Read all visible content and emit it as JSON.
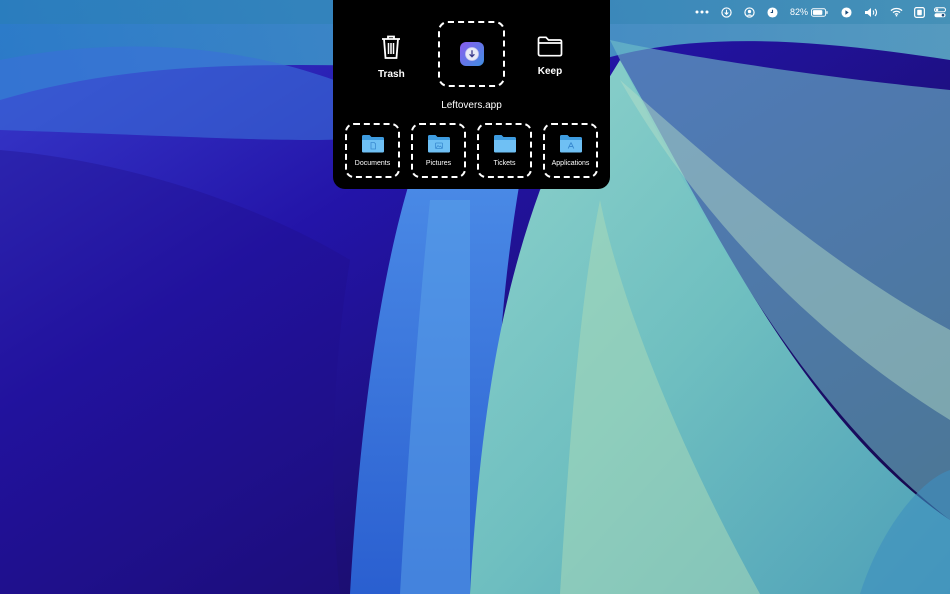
{
  "menubar": {
    "battery_percent": "82%",
    "icons": [
      "more-icon",
      "download-icon",
      "user-circle-icon",
      "clock-icon",
      "battery-icon",
      "play-icon",
      "volume-icon",
      "wifi-icon",
      "screen-icon",
      "control-center-icon"
    ]
  },
  "panel": {
    "trash_label": "Trash",
    "keep_label": "Keep",
    "app_name": "Leftovers.app",
    "folders": [
      {
        "label": "Documents",
        "icon": "documents-folder-icon"
      },
      {
        "label": "Pictures",
        "icon": "pictures-folder-icon"
      },
      {
        "label": "Tickets",
        "icon": "tickets-folder-icon"
      },
      {
        "label": "Applications",
        "icon": "applications-folder-icon"
      }
    ]
  },
  "colors": {
    "panel_bg": "#000000",
    "folder_blue": "#5fb4f0",
    "app_icon_start": "#8a5cf0",
    "app_icon_end": "#3f8ee0"
  }
}
